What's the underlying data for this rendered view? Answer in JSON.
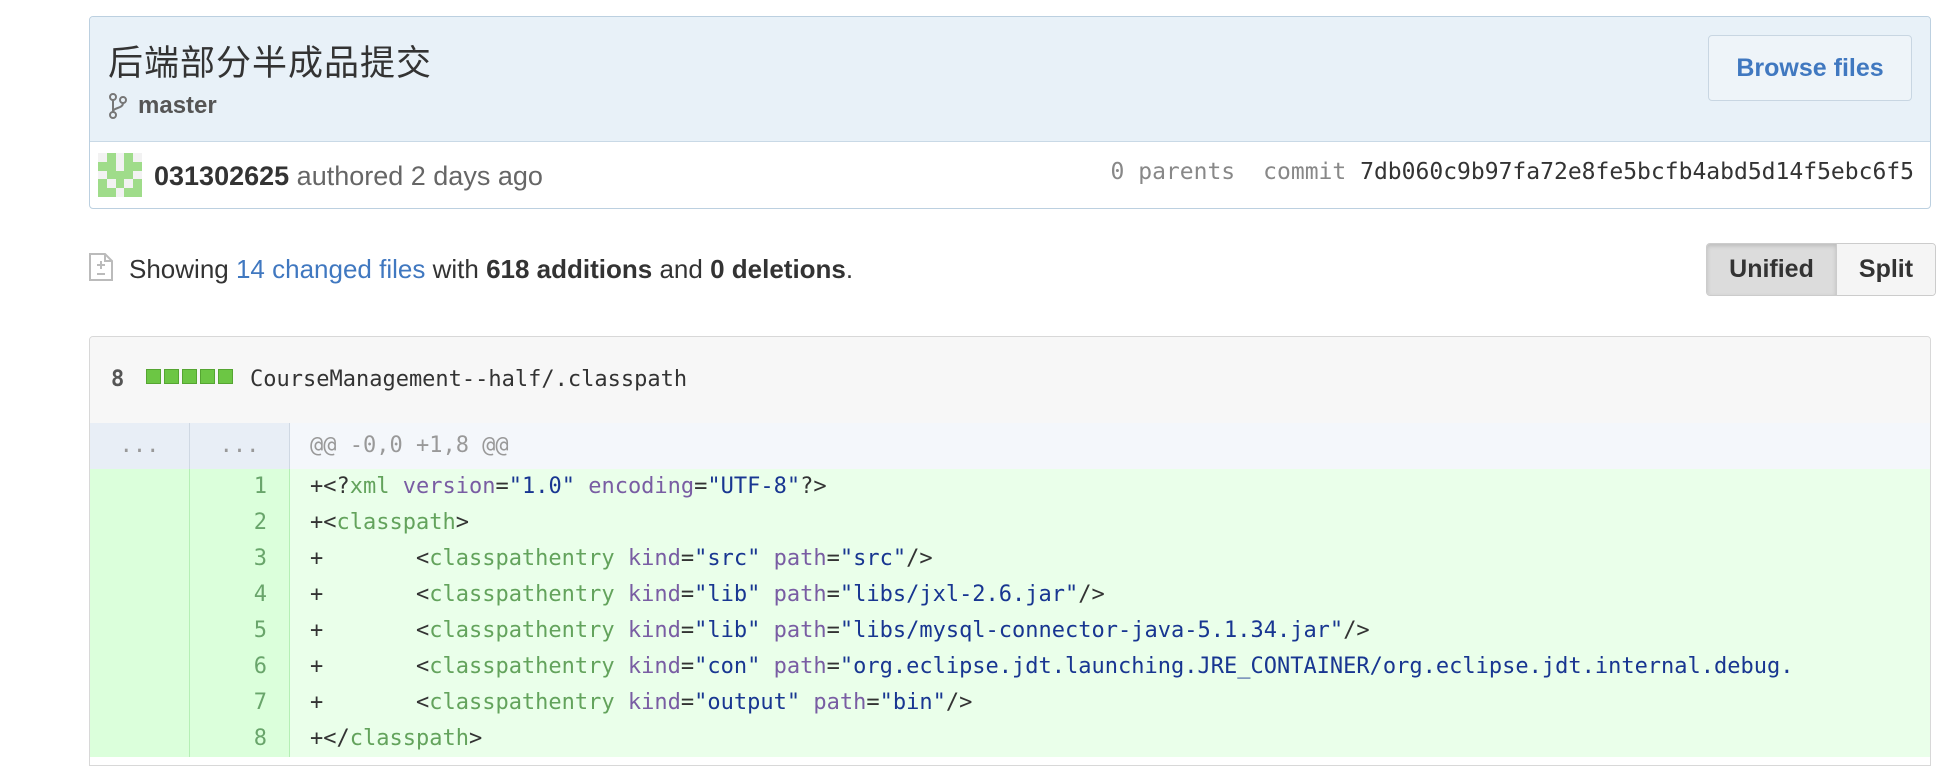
{
  "commit": {
    "title": "后端部分半成品提交",
    "branch": "master",
    "browse_label": "Browse files",
    "author": "031302625",
    "authored_text": "authored 2 days ago",
    "parents": "0 parents",
    "commit_label": "commit",
    "sha": "7db060c9b97fa72e8fe5bcfb4abd5d14f5ebc6f5"
  },
  "toc": {
    "showing": "Showing",
    "changed_files": "14 changed files",
    "with": "with",
    "additions": "618 additions",
    "and": "and",
    "deletions": "0 deletions",
    "period": "."
  },
  "view_toggle": {
    "unified": "Unified",
    "split": "Split"
  },
  "file": {
    "change_count": "8",
    "path": "CourseManagement--half/.classpath",
    "hunk_old": "...",
    "hunk_new": "...",
    "hunk_header": "@@ -0,0 +1,8 @@",
    "lines": [
      {
        "num": "1"
      },
      {
        "num": "2"
      },
      {
        "num": "3"
      },
      {
        "num": "4"
      },
      {
        "num": "5"
      },
      {
        "num": "6"
      },
      {
        "num": "7"
      },
      {
        "num": "8"
      }
    ]
  },
  "colors": {
    "link": "#4078c0",
    "addition_bg": "#eaffea",
    "addition_gutter": "#dbffdb",
    "diffstat_add": "#6cc644"
  }
}
